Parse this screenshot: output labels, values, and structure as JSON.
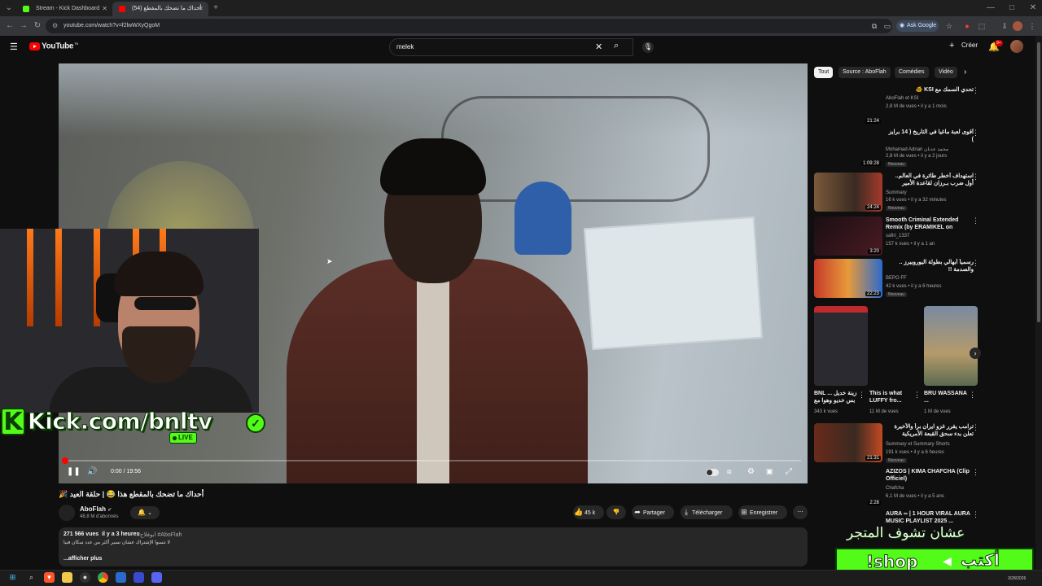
{
  "browser": {
    "tabs": [
      {
        "title": "Stream - Kick Dashboard",
        "color": "#53fc18"
      },
      {
        "title": "(54) أحداك ما تضحك بالمقطع",
        "color": "#ff0000"
      }
    ],
    "url": "youtube.com/watch?v=f2lwWXyQgoM",
    "ask_google": "Ask Google"
  },
  "youtube": {
    "logo": "YouTube",
    "logo_sup": "TN",
    "search_value": "melek",
    "create_label": "Créer",
    "notif_count": "9+"
  },
  "player": {
    "time": "0:00 / 19:56",
    "progress": 0.0
  },
  "stream_overlay": {
    "kick_url": "Kick.com/bnltv",
    "live_label": "LIVE",
    "shop_text_arabic": "عشان تشوف المتجر",
    "shop_command": "!shop",
    "shop_write": "أكتب"
  },
  "video": {
    "title": "أحداك ما تضحك بالمقطع هذا 😂 | حلقة العيد 🎉",
    "channel": "AboFlah",
    "subscribers": "48,8 M d'abonnés",
    "likes": "45 k",
    "share_label": "Partager",
    "download_label": "Télécharger",
    "save_label": "Enregistrer",
    "views": "271 566 vues",
    "ago": "il y a 3 heures",
    "hashtags": "#ابوفلاح #AboFlah",
    "desc_line": "لا تنسوا الإشتراك عشان نسير أكثر من عدد سكان فنيا",
    "more_label": "...afficher plus"
  },
  "sidebar": {
    "chips": [
      "Tout",
      "Source : AboFlah",
      "Comédies",
      "Vidéo"
    ],
    "recs": [
      {
        "title": "تحدي السمك مع KSI 🐠",
        "channel": "AboFlah et KSI",
        "meta": "2,8 M de vues • il y a 1 mois",
        "dur": "21:24",
        "new": ""
      },
      {
        "title": "أقوى لعبة ماغيا في التاريخ ( 14 برايز )",
        "channel": "Mohamad Adnan محمد عدنان",
        "meta": "2,8 M de vues • il y a 2 jours",
        "dur": "1:09:28",
        "new": "Nouveau"
      },
      {
        "title": "استهداف أخطر طائرة في العالم.. أول ضرب بـرزان لقاعدة الأمير سلطان بالسعودية وعلاقة",
        "channel": "Summary",
        "meta": "16 k vues • il y a 32 minutes",
        "dur": "24:24",
        "new": "Nouveau"
      },
      {
        "title": "Smooth Criminal Extended Remix (by ERAMIKEL on tiktok...",
        "channel": "safiri_1337",
        "meta": "157 k vues • il y a 1 an",
        "dur": "3:20",
        "new": ""
      },
      {
        "title": "رسمياً أبهالي بطولة اليوروبيرز .. والصدمة !!",
        "channel": "BEPO FF",
        "meta": "42 k vues • il y a 6 heures",
        "dur": "22:23",
        "new": "Nouveau"
      },
      {
        "title": "ترامب يقرر غزو ايران براً والأخيرة تعلن بدء سحق القبعة الأمريكية",
        "channel": "Summary et Summary Shorts",
        "meta": "191 k vues • il y a 6 heures",
        "dur": "21:31",
        "new": "Nouveau"
      },
      {
        "title": "AZIZOS | KIMA CHAFCHA (Clip Officiel)",
        "channel": "Chafcha",
        "meta": "6,1 M de vues • il y a 5 ans",
        "dur": "2:28",
        "new": ""
      },
      {
        "title": "AURA ∞ | 1 HOUR VIRAL AURA MUSIC PLAYLIST 2025 ...",
        "channel": "",
        "meta": "",
        "dur": "",
        "new": ""
      }
    ],
    "shorts": [
      {
        "title": "BNL زينة خديل ... بس خديو وهوا مع",
        "views": "343 k vues"
      },
      {
        "title": "This is what LUFFY fro...",
        "views": "11 M de vues"
      },
      {
        "title": "BRU WASSANA ...",
        "views": "1 M de vues"
      }
    ]
  },
  "taskbar": {
    "date": "3/28/2026"
  }
}
